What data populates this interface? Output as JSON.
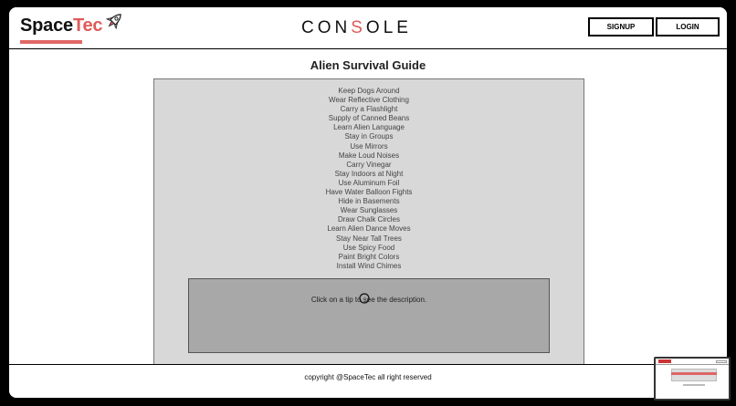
{
  "header": {
    "logo_prefix": "Space",
    "logo_suffix": "Tec",
    "console_before": "CON",
    "console_highlight": "S",
    "console_after": "OLE",
    "signup_label": "SIGNUP",
    "login_label": "LOGIN"
  },
  "main": {
    "title": "Alien Survival Guide",
    "tips": [
      "Keep Dogs Around",
      "Wear Reflective Clothing",
      "Carry a Flashlight",
      "Supply of Canned Beans",
      "Learn Alien Language",
      "Stay in Groups",
      "Use Mirrors",
      "Make Loud Noises",
      "Carry Vinegar",
      "Stay Indoors at Night",
      "Use Aluminum Foil",
      "Have Water Balloon Fights",
      "Hide in Basements",
      "Wear Sunglasses",
      "Draw Chalk Circles",
      "Learn Alien Dance Moves",
      "Stay Near Tall Trees",
      "Use Spicy Food",
      "Paint Bright Colors",
      "Install Wind Chimes"
    ],
    "description_prompt": "Click on a tip to see the description."
  },
  "footer": {
    "copyright": "copyright @SpaceTec all right reserved"
  },
  "colors": {
    "brand_accent": "#e05a5a",
    "panel_bg": "#d8d8d8",
    "description_bg": "#a8a8a8"
  },
  "icons": {
    "logo_icon": "rocket-icon",
    "cursor": "cursor-circle-icon"
  }
}
